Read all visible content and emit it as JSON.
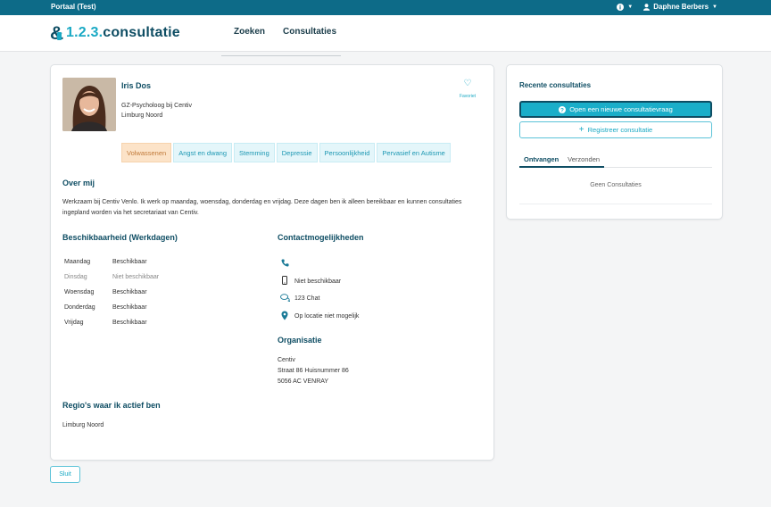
{
  "topbar": {
    "portal": "Portaal (Test)",
    "user": "Daphne Berbers"
  },
  "logo": {
    "amp": "&",
    "digits": "1.2.3.",
    "word": "consultatie"
  },
  "nav": {
    "items": [
      "Zoeken",
      "Consultaties"
    ]
  },
  "profile": {
    "name": "Iris Dos",
    "role": "GZ-Psycholoog bij Centiv",
    "region": "Limburg Noord",
    "favorite_label": "Favoriet",
    "tags": [
      {
        "label": "Volwassenen",
        "active": true
      },
      {
        "label": "Angst en dwang",
        "active": false
      },
      {
        "label": "Stemming",
        "active": false
      },
      {
        "label": "Depressie",
        "active": false
      },
      {
        "label": "Persoonlijkheid",
        "active": false
      },
      {
        "label": "Pervasief en Autisme",
        "active": false
      }
    ],
    "about_title": "Over mij",
    "about_text": "Werkzaam bij Centiv Venlo. Ik werk op maandag, woensdag, donderdag en vrijdag. Deze dagen ben ik alleen bereikbaar en kunnen consultaties ingepland worden via het secretariaat van Centiv.",
    "availability_title": "Beschikbaarheid (Werkdagen)",
    "availability": [
      {
        "day": "Maandag",
        "status": "Beschikbaar",
        "available": true
      },
      {
        "day": "Dinsdag",
        "status": "Niet beschikbaar",
        "available": false
      },
      {
        "day": "Woensdag",
        "status": "Beschikbaar",
        "available": true
      },
      {
        "day": "Donderdag",
        "status": "Beschikbaar",
        "available": true
      },
      {
        "day": "Vrijdag",
        "status": "Beschikbaar",
        "available": true
      }
    ],
    "contact_title": "Contactmogelijkheden",
    "contact": [
      {
        "icon": "phone-icon",
        "text": ""
      },
      {
        "icon": "mobile-icon",
        "text": "Niet beschikbaar"
      },
      {
        "icon": "chat-icon",
        "text": "123 Chat"
      },
      {
        "icon": "location-icon",
        "text": "Op locatie niet mogelijk"
      }
    ],
    "org_title": "Organisatie",
    "org_lines": [
      "Centiv",
      "Straat 86 Huisnummer 86",
      "5056 AC VENRAY"
    ],
    "regions_title": "Regio's waar ik actief ben",
    "regions_text": "Limburg Noord"
  },
  "close_button": "Sluit",
  "recent": {
    "title": "Recente consultaties",
    "new_button": "Open een nieuwe consultatievraag",
    "register_button": "Registreer consultatie",
    "tabs": [
      {
        "label": "Ontvangen",
        "active": true
      },
      {
        "label": "Verzonden",
        "active": false
      }
    ],
    "empty": "Geen Consultaties"
  },
  "colors": {
    "topbar": "#0d6b88",
    "primary": "#1aaec9",
    "dark": "#0e4d63",
    "tag_active_bg": "#fce3c8"
  }
}
